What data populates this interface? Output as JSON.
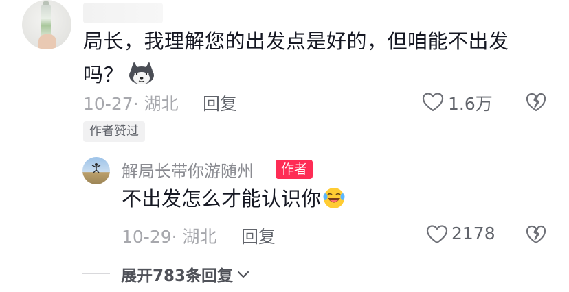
{
  "comment": {
    "text_line1": "局长，我理解您的出发点是好的，但咱能不出发",
    "text_line2": "吗？",
    "emoji": "husky-emoji",
    "date_location": "10-27· 湖北",
    "reply_label": "回复",
    "like_count": "1.6万",
    "author_liked_badge": "作者赞过"
  },
  "reply": {
    "username": "解局长带你游随州",
    "author_tag": "作者",
    "text": "不出发怎么才能认识你",
    "emoji": "laughing-crying-emoji",
    "date_location": "10-29· 湖北",
    "reply_label": "回复",
    "like_count": "2178"
  },
  "expand": {
    "label": "展开783条回复"
  },
  "colors": {
    "author_tag_bg": "#fe2c55",
    "meta_gray": "#a7a8ad",
    "text_dark": "#161823"
  }
}
